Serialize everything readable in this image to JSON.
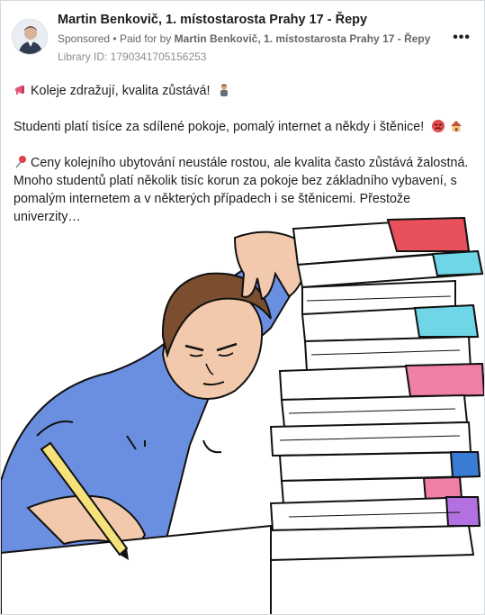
{
  "post": {
    "author": "Martin Benkovič, 1. místostarosta Prahy 17 - Řepy",
    "sponsored": "Sponsored",
    "paid_for_prefix": "Paid for by",
    "paid_for_name": "Martin Benkovič, 1. místostarosta Prahy 17 - Řepy",
    "library_id": "Library ID: 1790341705156253",
    "more_label": "•••",
    "line1": "Koleje zdražují, kvalita zůstává!",
    "line2": "Studenti platí tisíce za sdílené pokoje, pomalý internet a někdy i štěnice!",
    "line3a": "Ceny kolejního ubytování neustále rostou, ale kvalita často zůstává žalostná.",
    "line3b": "Mnoho studentů platí několik tisíc korun za pokoje bez základního vybavení, s",
    "line3c": "pomalým internetem a v některých případech i se štěnicemi. Přestože univerzity…"
  },
  "icons": {
    "line1_leading": "megaphone-icon",
    "line1_trailing": "person-icon",
    "line2_trailing_1": "angry-face-icon",
    "line2_trailing_2": "house-icon",
    "line3_leading": "pushpin-icon"
  },
  "colors": {
    "name": "#1c1e21",
    "meta": "#65676b",
    "shirt": "#6b8fe0",
    "book_red": "#e8505b",
    "book_pink": "#ef7fa4",
    "book_cyan": "#6ed6e6",
    "book_blue": "#3a7bd5",
    "book_purple": "#b270e0",
    "pencil": "#f6e27a"
  }
}
